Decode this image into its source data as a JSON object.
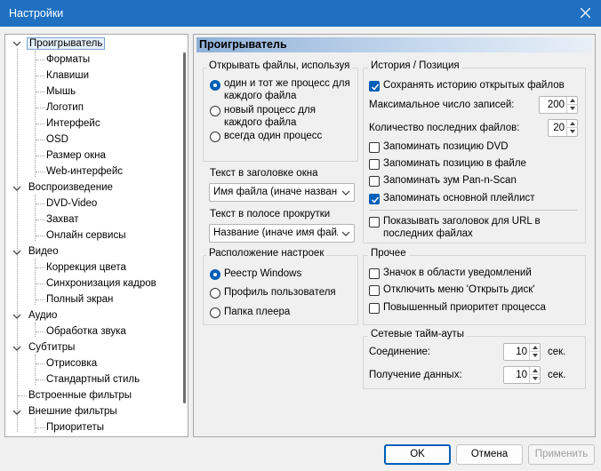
{
  "window": {
    "title": "Настройки"
  },
  "tree": {
    "items": [
      {
        "label": "Проигрыватель",
        "selected": true
      },
      {
        "label": "Форматы"
      },
      {
        "label": "Клавиши"
      },
      {
        "label": "Мышь"
      },
      {
        "label": "Логотип"
      },
      {
        "label": "Интерфейс"
      },
      {
        "label": "OSD"
      },
      {
        "label": "Размер окна"
      },
      {
        "label": "Web-интерфейс"
      },
      {
        "label": "Воспроизведение"
      },
      {
        "label": "DVD-Video"
      },
      {
        "label": "Захват"
      },
      {
        "label": "Онлайн сервисы"
      },
      {
        "label": "Видео"
      },
      {
        "label": "Коррекция цвета"
      },
      {
        "label": "Синхронизация кадров"
      },
      {
        "label": "Полный экран"
      },
      {
        "label": "Аудио"
      },
      {
        "label": "Обработка звука"
      },
      {
        "label": "Субтитры"
      },
      {
        "label": "Отрисовка"
      },
      {
        "label": "Стандартный стиль"
      },
      {
        "label": "Встроенные фильтры"
      },
      {
        "label": "Внешние фильтры"
      },
      {
        "label": "Приоритеты"
      }
    ]
  },
  "panel": {
    "header": "Проигрыватель",
    "open_files": {
      "title": "Открывать файлы, используя",
      "options": [
        {
          "line1": "один и тот же процесс для",
          "line2": "каждого файла",
          "selected": true
        },
        {
          "line1": "новый процесс для",
          "line2": "каждого файла",
          "selected": false
        },
        {
          "line1": "всегда один процесс",
          "line2": "",
          "selected": false
        }
      ]
    },
    "window_title": {
      "label": "Текст в заголовке окна",
      "value": "Имя файла (иначе название"
    },
    "seekbar_text": {
      "label": "Текст в полосе прокрутки",
      "value": "Название (иначе имя файла"
    },
    "settings_location": {
      "title": "Расположение настроек",
      "options": [
        {
          "label": "Реестр Windows",
          "selected": true
        },
        {
          "label": "Профиль пользователя",
          "selected": false
        },
        {
          "label": "Папка плеера",
          "selected": false
        }
      ]
    },
    "history": {
      "title": "История / Позиция",
      "save_history": {
        "label": "Сохранять историю открытых файлов",
        "checked": true
      },
      "max_records": {
        "label": "Максимальное число записей:",
        "value": "200"
      },
      "recent_files": {
        "label": "Количество последних файлов:",
        "value": "20"
      },
      "options": [
        {
          "label": "Запоминать позицию DVD",
          "checked": false
        },
        {
          "label": "Запоминать позицию в файле",
          "checked": false
        },
        {
          "label": "Запоминать зум Pan-n-Scan",
          "checked": false
        },
        {
          "label": "Запоминать основной плейлист",
          "checked": true
        }
      ],
      "url_titles": {
        "line1": "Показывать заголовок для URL в",
        "line2": "последних файлах",
        "checked": false
      }
    },
    "other": {
      "title": "Прочее",
      "options": [
        {
          "label": "Значок в области уведомлений",
          "checked": false
        },
        {
          "label": "Отключить меню 'Открыть диск'",
          "checked": false
        },
        {
          "label": "Повышенный приоритет процесса",
          "checked": false
        }
      ]
    },
    "timeouts": {
      "title": "Сетевые тайм-ауты",
      "connect": {
        "label": "Соединение:",
        "value": "10",
        "unit": "сек."
      },
      "receive": {
        "label": "Получение данных:",
        "value": "10",
        "unit": "сек."
      }
    }
  },
  "buttons": {
    "ok": "OK",
    "cancel": "Отмена",
    "apply": "Применить"
  },
  "colors": {
    "titlebar": "#1f70c1",
    "accent": "#005fb8"
  }
}
